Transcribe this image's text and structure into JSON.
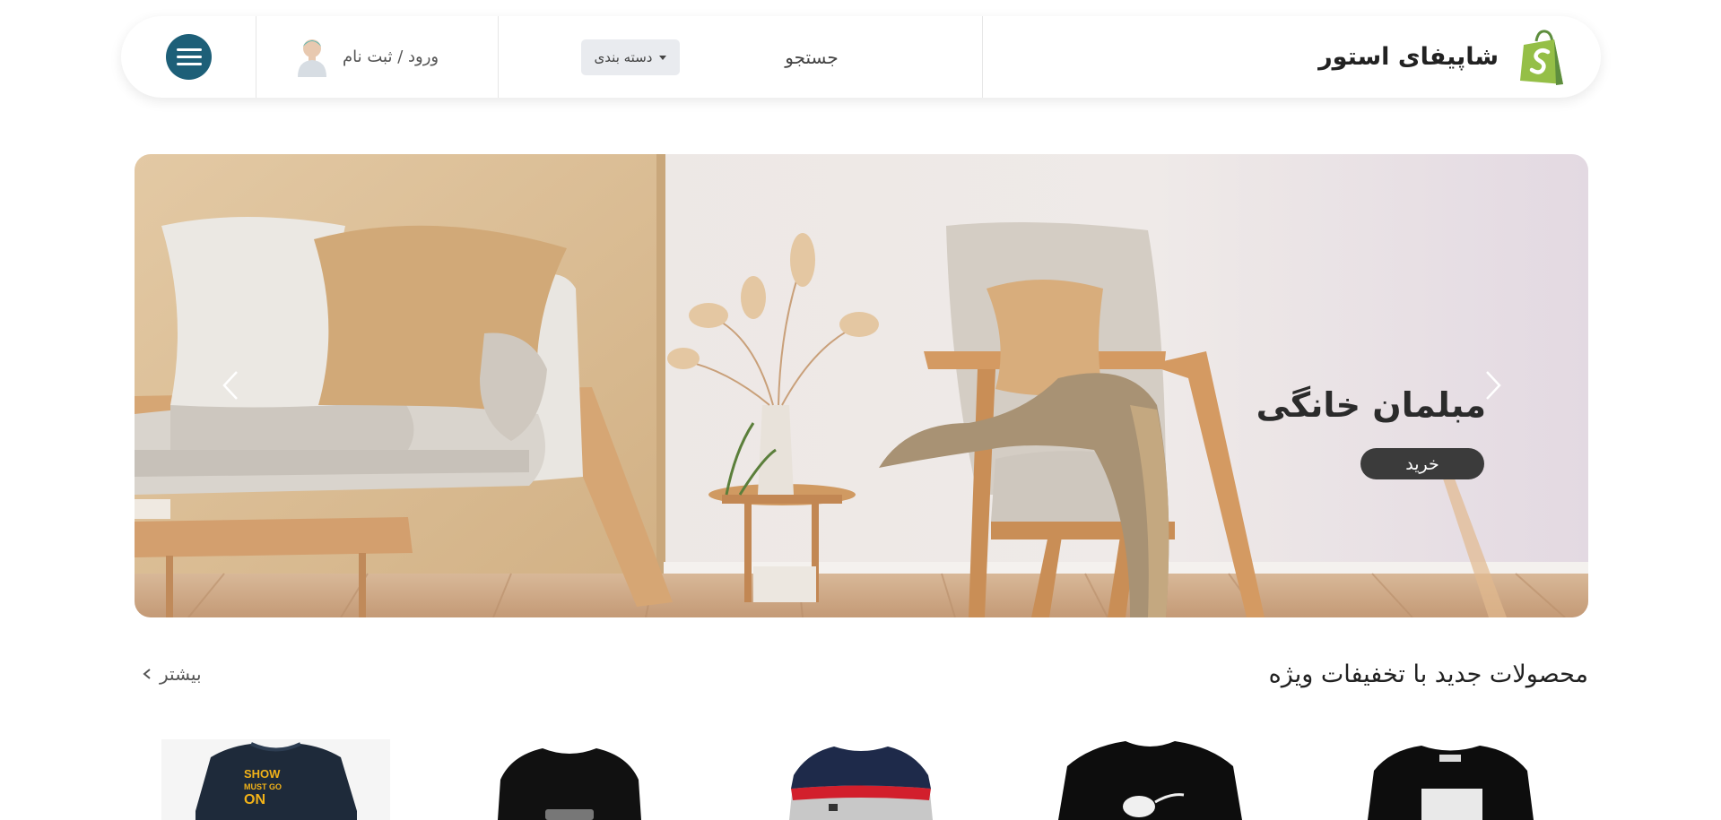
{
  "header": {
    "brand_name": "شاپیفای استور",
    "brand_logo": "shopify-bag-logo",
    "search_placeholder": "جستجو",
    "category_label": "دسته بندی",
    "login_label": "ورود / ثبت نام",
    "menu_icon": "hamburger-menu-icon",
    "accent_color": "#1d5f78"
  },
  "hero": {
    "slide_title": "مبلمان خانگی",
    "buy_label": "خرید",
    "prev_icon": "chevron-left-icon",
    "next_icon": "chevron-right-icon"
  },
  "section": {
    "title": "محصولات جدید با تخفیفات ویژه",
    "more_label": "بیشتر"
  },
  "products": [
    {
      "name": "tshirt-show-must-go-on",
      "print_text": "SHOW MUST GO ON",
      "color": "#1e2a3a"
    },
    {
      "name": "tshirt-black-print",
      "color": "#111111"
    },
    {
      "name": "tshirt-navy-red-stripe",
      "color": "#c8c8c8"
    },
    {
      "name": "tshirt-black-graphic",
      "color": "#0d0d0d"
    },
    {
      "name": "tshirt-black-box-print",
      "color": "#0d0d0d"
    }
  ]
}
